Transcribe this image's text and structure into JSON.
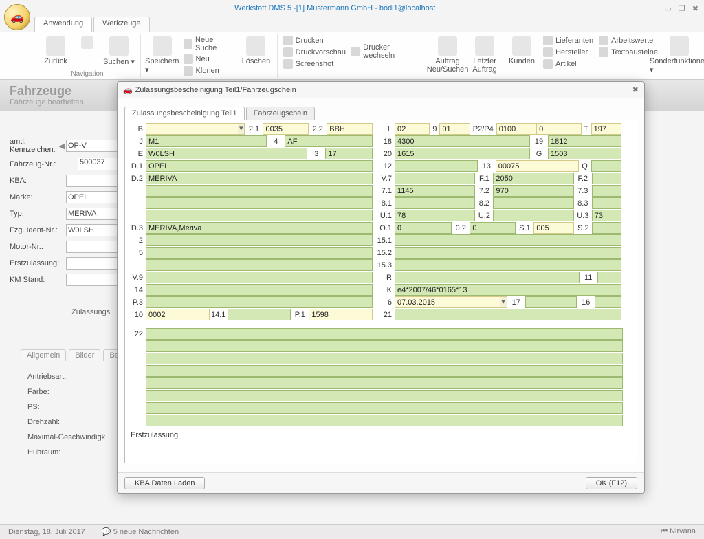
{
  "title": "Werkstatt DMS 5 -[1] Mustermann GmbH - bodi1@localhost",
  "ribbonTabs": {
    "app": "Anwendung",
    "tools": "Werkzeuge"
  },
  "ribbon": {
    "nav": {
      "back": "Zurück",
      "search": "Suchen",
      "label": "Navigation"
    },
    "save": "Speichern",
    "newsearch": "Neue Suche",
    "neu": "Neu",
    "klonen": "Klonen",
    "delete": "Löschen",
    "drucken": "Drucken",
    "vorschau": "Druckvorschau",
    "screenshot": "Screenshot",
    "wechseln": "Drucker wechseln",
    "auftragNeu": "Auftrag Neu/Suchen",
    "letzter": "Letzter Auftrag",
    "kunden": "Kunden",
    "lieferanten": "Lieferanten",
    "hersteller": "Hersteller",
    "artikel": "Artikel",
    "arbeitswerte": "Arbeitswerte",
    "textbausteine": "Textbausteine",
    "sonder": "Sonderfunktionen"
  },
  "page": {
    "heading": "Fahrzeuge",
    "sub": "Fahrzeuge bearbeiten"
  },
  "behind": {
    "kennzL": "amtl. Kennzeichen:",
    "kennzV": "OP-V",
    "fzgNrL": "Fahrzeug-Nr.:",
    "fzgNrV": "500037",
    "kbaL": "KBA:",
    "markeL": "Marke:",
    "markeV": "OPEL",
    "typL": "Typ:",
    "typV": "MERIVA",
    "identL": "Fzg. Ident-Nr.:",
    "identV": "W0LSH",
    "motorL": "Motor-Nr.:",
    "erstzL": "Erstzulassung:",
    "kmL": "KM Stand:",
    "zulBtn": "Zulassungs",
    "tabs": {
      "allg": "Allgemein",
      "bilder": "Bilder",
      "bem": "Bem"
    },
    "props": {
      "antrieb": "Antriebsart:",
      "farbe": "Farbe:",
      "ps": "PS:",
      "drehzahl": "Drehzahl:",
      "maxg": "Maximal-Geschwindigk",
      "hubraum": "Hubraum:"
    }
  },
  "dialog": {
    "title": "Zulassungsbescheinigung Teil1/Fahrzeugschein",
    "tab1": "Zulassungsbescheinigung Teil1",
    "tab2": "Fahrzeugschein",
    "left": {
      "B_21": "2.1",
      "B_21v": "0035",
      "B_22": "2.2",
      "B_22v": "BBH",
      "J": "M1",
      "J4": "4",
      "Jaf": "AF",
      "E": "W0LSH",
      "E3": "3",
      "E17": "17",
      "D1": "OPEL",
      "D2": "MERIVA",
      "D3": "MERIVA,Meriva",
      "ten": "0002",
      "t141": "14.1",
      "P1": "P.1",
      "P1v": "1598"
    },
    "right": {
      "L": "02",
      "L9": "9",
      "L01": "01",
      "P2P4": "P2/P4",
      "P2v": "0100",
      "Lz": "0",
      "LT": "T",
      "LTv": "197",
      "r18": "4300",
      "r18_19": "19",
      "r18v": "1812",
      "r20": "1615",
      "r20G": "G",
      "r20v": "1503",
      "r12_13": "13",
      "r12v": "00075",
      "r12Q": "Q",
      "v7F1": "F.1",
      "v7F1v": "2050",
      "v7F2": "F.2",
      "r71": "1145",
      "r72": "7.2",
      "r72v": "970",
      "r73": "7.3",
      "r82": "8.2",
      "r83": "8.3",
      "U1": "78",
      "U2": "U.2",
      "U3": "U.3",
      "U3v": "73",
      "O1": "0",
      "O2": "0.2",
      "O2v": "0",
      "S1": "S.1",
      "S1v": "005",
      "S2": "S.2",
      "r11": "11",
      "K": "e4*2007/46*0165*13",
      "six": "07.03.2015",
      "six17": "17",
      "six16": "16"
    },
    "bottom22": "22",
    "footer": "Erstzulassung",
    "btnKba": "KBA Daten Laden",
    "btnOk": "OK (F12)"
  },
  "status": {
    "date": "Dienstag, 18. Juli 2017",
    "msgs": "5 neue Nachrichten",
    "right": "Nirvana"
  }
}
